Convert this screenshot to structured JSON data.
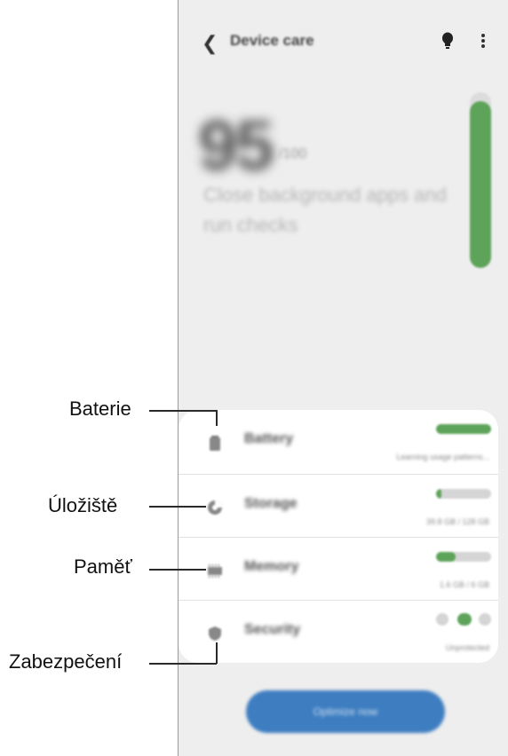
{
  "app": {
    "title": "Device care",
    "back_icon": "chevron-left-icon",
    "tips_icon": "lightbulb-icon",
    "more_icon": "more-vertical-icon"
  },
  "hero": {
    "score": "95",
    "score_unit": "/100",
    "message": "Close background apps and run checks",
    "level": 0.95
  },
  "rows": [
    {
      "label": "Battery",
      "sub": "Learning usage patterns...",
      "icon": "battery-icon",
      "level": 1.0
    },
    {
      "label": "Storage",
      "sub": "39.8 GB / 128 GB",
      "icon": "storage-pie-icon",
      "level": 0.1
    },
    {
      "label": "Memory",
      "sub": "1.6 GB / 6 GB",
      "icon": "memory-chip-icon",
      "level": 0.35
    },
    {
      "label": "Security",
      "sub": "Unprotected",
      "icon": "shield-icon"
    }
  ],
  "optimize_label": "Optimize now",
  "callouts": {
    "battery": "Baterie",
    "storage": "Úložiště",
    "memory": "Paměť",
    "security": "Zabezpečení"
  },
  "colors": {
    "accent_green": "#5ea35a",
    "button_blue": "#3d7dc0",
    "screen_bg": "#eeeeee",
    "card_bg": "#ffffff"
  }
}
